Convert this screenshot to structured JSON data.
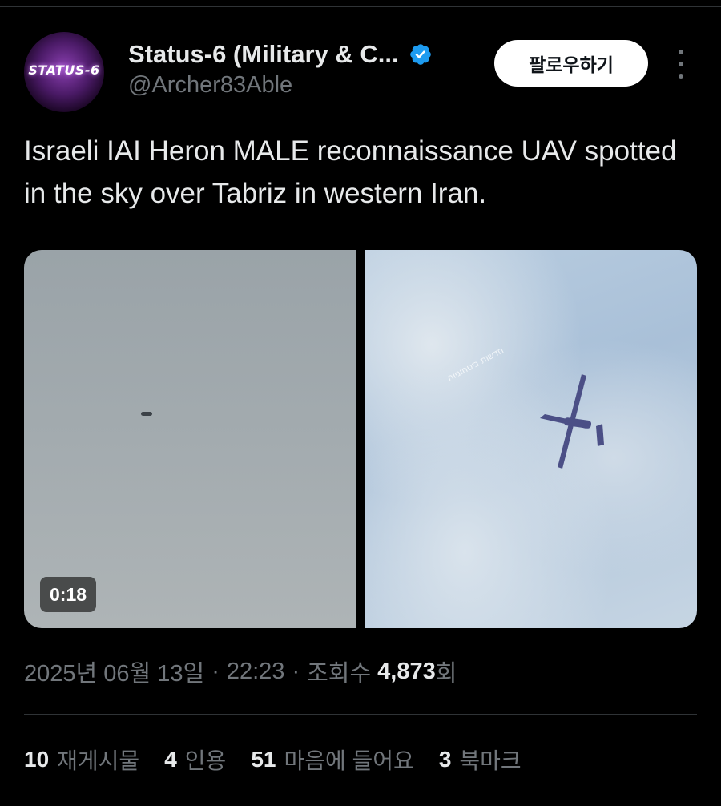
{
  "author": {
    "avatar_text": "STATUS-6",
    "display_name": "Status-6 (Military & C...",
    "handle": "@Archer83Able",
    "verified": true
  },
  "follow_button": {
    "label": "팔로우하기"
  },
  "tweet": {
    "text": "Israeli IAI Heron MALE reconnaissance UAV spotted in the sky over Tabriz in western Iran."
  },
  "media": {
    "video_duration": "0:18",
    "watermark": "חדשות ביטחוניות"
  },
  "meta": {
    "date": "2025년 06월 13일",
    "separator": "·",
    "time": "22:23",
    "views_label": "조회수",
    "views_count": "4,873",
    "views_suffix": "회"
  },
  "stats": [
    {
      "count": "10",
      "label": "재게시물"
    },
    {
      "count": "4",
      "label": "인용"
    },
    {
      "count": "51",
      "label": "마음에 들어요"
    },
    {
      "count": "3",
      "label": "북마크"
    }
  ],
  "colors": {
    "background": "#000000",
    "primary_text": "#e7e9ea",
    "secondary_text": "#71767b",
    "verified_badge": "#1d9bf0",
    "follow_button_bg": "#ffffff"
  },
  "icons": [
    "verified-badge-icon",
    "more-options-icon"
  ]
}
